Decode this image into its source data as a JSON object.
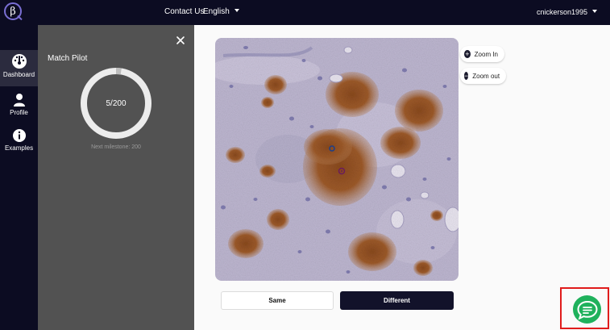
{
  "topbar": {
    "logo_text": "β",
    "contact_label": "Contact Us",
    "language_label": "English",
    "username": "cnickerson1995"
  },
  "nav": {
    "items": [
      {
        "label": "Dashboard",
        "icon": "gauge-icon",
        "active": true
      },
      {
        "label": "Profile",
        "icon": "user-icon",
        "active": false
      },
      {
        "label": "Examples",
        "icon": "info-icon",
        "active": false
      }
    ]
  },
  "panel": {
    "title": "Match Pilot",
    "progress_text": "5/200",
    "progress_fraction": 0.025,
    "note": "Next milestone: 200",
    "close_icon": "close-icon"
  },
  "viewer": {
    "zoom_in_label": "Zoom In",
    "zoom_out_label": "Zoom out"
  },
  "actions": {
    "same_label": "Same",
    "different_label": "Different"
  },
  "chat": {
    "icon": "chat-icon",
    "color": "#1fb15c",
    "highlight_color": "#e01b1b"
  },
  "colors": {
    "navbar": "#0c0c22",
    "panel": "#525252",
    "accent": "#7a6fd4"
  }
}
